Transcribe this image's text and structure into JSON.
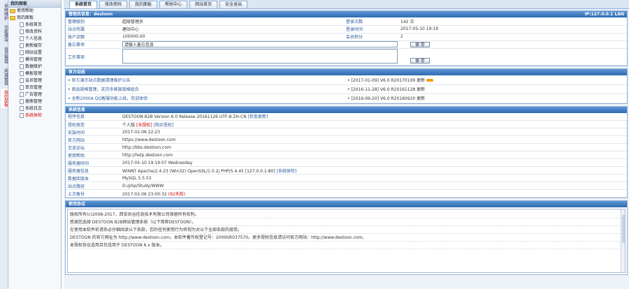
{
  "left_tabs": [
    "系统维护",
    "功能模块",
    "会员管理",
    "商城管理",
    "我的面板"
  ],
  "tree": {
    "title": "我的面板",
    "root_items": [
      "使用帮助",
      "我的面板"
    ],
    "children": [
      "系统首页",
      "修改资料",
      "个人信息",
      "更新缓存",
      "网站设置",
      "模块管理",
      "数据维护",
      "模板管理",
      "会员管理",
      "单页管理",
      "广告管理",
      "搜索管理",
      "系统日志",
      "系统体检"
    ],
    "red_children": [
      "系统体检"
    ]
  },
  "tabs": [
    "系统首页",
    "修改密码",
    "我的面板",
    "帮助中心",
    "网站首页",
    "安全退出"
  ],
  "account": {
    "title": "管理员信息：destoon",
    "ip": "IP:127.0.0.1 LAN",
    "rows": [
      {
        "l1": "管理级别",
        "v1": "超级管理员",
        "l2": "登录次数",
        "v2": "142 次"
      },
      {
        "l1": "站点所属",
        "v1": "建站中心",
        "l2": "登录时间",
        "v2": "2017-05-10 19:19"
      },
      {
        "l1": "账户余额",
        "v1": "100000.00",
        "l2": "会员积分",
        "v2": "2"
      }
    ],
    "notes_label": "备忘事项",
    "notes_value": "请输入备忘信息",
    "notes_btn": "保 存",
    "work_label": "工作事项",
    "work_btn": "保 存"
  },
  "notices": {
    "title": "官方动态",
    "items": [
      {
        "text": "官方演示站点数据清理维护公告",
        "date": "[2017-01-09]",
        "ver": "V6.0 R20170109 更新",
        "new": true
      },
      {
        "text": "商品规格管理，支持多维度规格组合",
        "date": "[2016-11-28]",
        "ver": "V6.0 R20161128 更新",
        "new": false
      },
      {
        "text": "全新2000A QQ客服功能上线，欢迎体验",
        "date": "[2016-09-20]",
        "ver": "V6.0 R20160920 更新",
        "new": false
      }
    ]
  },
  "sysinfo": {
    "title": "系统信息",
    "rows": [
      {
        "label": "程序信息",
        "value": "DESTOON B2B Version 6.0 Release 20161126 UTF-8 ZH-CN",
        "link": "[检查更新]"
      },
      {
        "label": "授权类型",
        "value": "个人版",
        "red": "[未授权]",
        "link": "[购买授权]"
      },
      {
        "label": "安装时间",
        "value": "2017-02-06 22:23"
      },
      {
        "label": "官方网站",
        "value": "https://www.destoon.com"
      },
      {
        "label": "交流论坛",
        "value": "http://bbs.destoon.com"
      },
      {
        "label": "使用帮助",
        "value": "http://help.destoon.com"
      },
      {
        "label": "服务器时间",
        "value": "2017-05-10 19:19:07 Wednesday"
      },
      {
        "label": "服务器信息",
        "value": "WINNT Apache/2.4.23 (Win32) OpenSSL/1.0.2j PHP/5.4.45 [127.0.0.1:80]",
        "link": "[系统体检]"
      },
      {
        "label": "数据库版本",
        "value": "MySQL 5.5.53"
      },
      {
        "label": "站点路径",
        "value": "D:/php/Study/WWW"
      },
      {
        "label": "上次备份",
        "value": "2017-02-06 23:00:32",
        "red": "(92天前)"
      }
    ]
  },
  "license": {
    "title": "使用协议",
    "lines": [
      "版权所有(c)2008-2017，西安尚谷信息技术有限公司保留所有权利。",
      "感谢您选择 DESTOON B2B网站管理系统（以下简称DESTOON）。",
      "在使用本软件前请务必仔细阅读以下条款，您的任何使用行为将视为对以下全部条款的接受。",
      "DESTOON 的官方网址为 http://www.destoon.com，本软件著作权登记号：2009SR037570。更多授权信息请访问官方网站：http://www.destoon.com。",
      "本授权协议适用且仅适用于 DESTOON 6.x 版本。"
    ]
  },
  "colors": {
    "head": "#2e69b0",
    "accent_red": "#c00",
    "link": "#2a5a9a"
  }
}
